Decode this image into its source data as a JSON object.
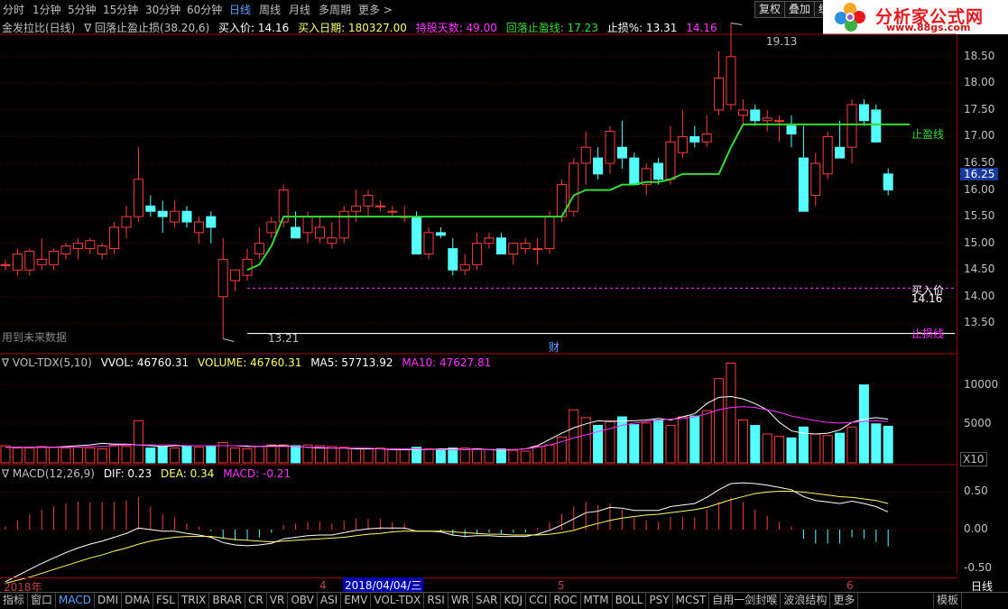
{
  "periods": [
    "分时",
    "1分钟",
    "5分钟",
    "15分钟",
    "30分钟",
    "60分钟",
    "日线",
    "周线",
    "月线",
    "多周期",
    "更多"
  ],
  "active_period": "日线",
  "right_buttons": [
    "复权",
    "叠加",
    "统"
  ],
  "logo": {
    "title": "分析家公式网",
    "url": "www.88gs.com"
  },
  "info": {
    "name": "金发拉比(日线)",
    "indicator": "∇ 回落止盈止损(38.20,6)",
    "buy_price": "买入价: 14.16",
    "buy_date": "买入日期: 180327.00",
    "hold_days": "持股天数: 49.00",
    "takeprofit_line": "回落止盈线: 17.23",
    "stoploss_pct": "止损%: 13.31",
    "value": "14.16"
  },
  "price_axis": [
    "18.50",
    "18.00",
    "17.50",
    "17.00",
    "16.50",
    "16.00",
    "15.50",
    "15.00",
    "14.50",
    "14.00",
    "13.50"
  ],
  "current_price_tag": "16.25",
  "labels": {
    "high": "19.13",
    "low": "13.21",
    "buy": "买入价",
    "buy_val": "14.16",
    "takeprofit": "止盈线",
    "stoploss": "止损线",
    "future": "用到未来数据",
    "cai": "财"
  },
  "volume_header": {
    "name": "∇ VOL-TDX(5,10)",
    "vvol": "VVOL: 46760.31",
    "volume": "VOLUME: 46760.31",
    "ma5": "MA5: 57713.92",
    "ma10": "MA10: 47627.81"
  },
  "volume_axis": [
    "10000",
    "5000"
  ],
  "volume_unit": "X10",
  "macd_header": {
    "name": "∇ MACD(12,26,9)",
    "dif": "DIF: 0.23",
    "dea": "DEA: 0.34",
    "macd": "MACD: -0.21"
  },
  "macd_axis": [
    "0.50",
    "0.00",
    "-0.50"
  ],
  "date_axis": [
    "2018年",
    "4",
    "5",
    "6"
  ],
  "cursor_date": "2018/04/04/三",
  "period_label": "日线",
  "bottom_tabs": [
    "指标",
    "窗口",
    "MACD",
    "DMI",
    "DMA",
    "FSL",
    "TRIX",
    "BRAR",
    "CR",
    "VR",
    "OBV",
    "ASI",
    "EMV",
    "VOL-TDX",
    "RSI",
    "WR",
    "SAR",
    "KDJ",
    "CCI",
    "ROC",
    "MTM",
    "BOLL",
    "PSY",
    "MCST",
    "自用一剑封喉",
    "波浪结构",
    "更多"
  ],
  "active_bottom_tab": "MACD",
  "template_tab": "模板",
  "colors": {
    "up": "#ff3c3c",
    "down": "#54ffff",
    "green": "#33dd33",
    "magenta": "#ff33ff",
    "white": "#ffffff",
    "yellow": "#ffff66"
  },
  "chart_data": {
    "type": "candlestick",
    "candles": [
      [
        14.6,
        14.7,
        14.5,
        14.6
      ],
      [
        14.5,
        14.9,
        14.4,
        14.8
      ],
      [
        14.5,
        14.9,
        14.4,
        14.85
      ],
      [
        14.6,
        15.1,
        14.5,
        14.7
      ],
      [
        14.6,
        14.9,
        14.5,
        14.85
      ],
      [
        14.8,
        15.0,
        14.7,
        14.95
      ],
      [
        14.9,
        15.1,
        14.7,
        15.0
      ],
      [
        14.9,
        15.1,
        14.8,
        15.05
      ],
      [
        14.8,
        15.0,
        14.7,
        14.95
      ],
      [
        14.9,
        15.4,
        14.8,
        15.3
      ],
      [
        15.3,
        15.7,
        15.1,
        15.5
      ],
      [
        15.5,
        16.8,
        15.4,
        16.2
      ],
      [
        15.7,
        15.9,
        15.5,
        15.6
      ],
      [
        15.6,
        15.8,
        15.2,
        15.5
      ],
      [
        15.4,
        15.8,
        15.3,
        15.6
      ],
      [
        15.6,
        15.7,
        15.3,
        15.4
      ],
      [
        15.2,
        15.5,
        15.0,
        15.4
      ],
      [
        15.5,
        15.6,
        15.0,
        15.3
      ],
      [
        14.0,
        15.1,
        13.21,
        14.7
      ],
      [
        14.3,
        14.5,
        14.1,
        14.5
      ],
      [
        14.4,
        14.9,
        14.3,
        14.7
      ],
      [
        14.8,
        15.3,
        14.7,
        15.0
      ],
      [
        15.2,
        15.5,
        15.1,
        15.4
      ],
      [
        15.4,
        16.1,
        15.3,
        16.0
      ],
      [
        15.3,
        15.6,
        15.1,
        15.1
      ],
      [
        15.2,
        15.6,
        15.0,
        15.5
      ],
      [
        15.1,
        15.5,
        15.0,
        15.3
      ],
      [
        15.0,
        15.4,
        14.9,
        15.1
      ],
      [
        15.1,
        15.7,
        15.0,
        15.6
      ],
      [
        15.6,
        16.0,
        15.4,
        15.7
      ],
      [
        15.7,
        16.0,
        15.5,
        15.9
      ],
      [
        15.7,
        15.8,
        15.6,
        15.7
      ],
      [
        15.6,
        15.7,
        15.5,
        15.6
      ],
      [
        15.5,
        15.7,
        15.4,
        15.5
      ],
      [
        15.5,
        15.6,
        14.8,
        14.8
      ],
      [
        14.8,
        15.3,
        14.7,
        15.2
      ],
      [
        15.2,
        15.3,
        15.1,
        15.15
      ],
      [
        14.9,
        15.1,
        14.4,
        14.5
      ],
      [
        14.5,
        14.8,
        14.4,
        14.6
      ],
      [
        14.6,
        15.2,
        14.5,
        15.0
      ],
      [
        15.0,
        15.2,
        14.9,
        15.1
      ],
      [
        15.1,
        15.2,
        14.8,
        14.8
      ],
      [
        14.8,
        15.0,
        14.6,
        15.0
      ],
      [
        14.9,
        15.1,
        14.8,
        15.0
      ],
      [
        14.9,
        15.1,
        14.6,
        14.9
      ],
      [
        14.9,
        15.6,
        14.8,
        15.5
      ],
      [
        15.5,
        16.2,
        15.4,
        16.1
      ],
      [
        15.6,
        16.6,
        15.5,
        16.5
      ],
      [
        16.5,
        17.1,
        16.1,
        16.8
      ],
      [
        16.6,
        16.8,
        16.2,
        16.3
      ],
      [
        16.5,
        17.2,
        16.3,
        17.1
      ],
      [
        16.8,
        17.3,
        16.4,
        16.6
      ],
      [
        16.6,
        16.7,
        16.1,
        16.1
      ],
      [
        16.1,
        16.5,
        15.9,
        16.4
      ],
      [
        16.5,
        16.6,
        16.1,
        16.2
      ],
      [
        16.2,
        17.2,
        16.1,
        16.9
      ],
      [
        16.7,
        17.5,
        16.6,
        17.0
      ],
      [
        17.0,
        17.2,
        16.8,
        16.9
      ],
      [
        16.9,
        17.4,
        16.8,
        17.05
      ],
      [
        17.5,
        18.6,
        17.4,
        18.1
      ],
      [
        17.6,
        19.13,
        17.5,
        18.5
      ],
      [
        17.4,
        17.7,
        17.2,
        17.5
      ],
      [
        17.5,
        17.6,
        17.2,
        17.3
      ],
      [
        17.3,
        17.5,
        17.1,
        17.35
      ],
      [
        17.3,
        17.4,
        16.9,
        17.3
      ],
      [
        17.2,
        17.4,
        16.8,
        17.05
      ],
      [
        16.6,
        17.2,
        15.7,
        15.6
      ],
      [
        15.9,
        16.7,
        15.7,
        16.5
      ],
      [
        16.3,
        17.1,
        16.2,
        17.0
      ],
      [
        16.8,
        17.3,
        16.6,
        16.6
      ],
      [
        16.8,
        17.7,
        16.5,
        17.6
      ],
      [
        17.6,
        17.7,
        17.2,
        17.3
      ],
      [
        17.5,
        17.6,
        16.9,
        16.9
      ],
      [
        16.3,
        16.4,
        15.9,
        16.0
      ]
    ],
    "takeprofit_line": {
      "start_index": 20,
      "values": [
        14.5,
        14.6,
        14.95,
        15.5,
        15.5,
        15.5,
        15.5,
        15.5,
        15.5,
        15.5,
        15.5,
        15.5,
        15.5,
        15.5,
        15.5,
        15.5,
        15.5,
        15.5,
        15.5,
        15.5,
        15.5,
        15.5,
        15.5,
        15.5,
        15.5,
        15.5,
        15.5,
        15.9,
        16.0,
        16.0,
        16.0,
        16.1,
        16.1,
        16.15,
        16.15,
        16.2,
        16.3,
        16.3,
        16.3,
        16.3,
        16.8,
        17.23,
        17.23,
        17.23,
        17.23,
        17.23,
        17.23,
        17.23,
        17.23,
        17.23,
        17.23,
        17.23,
        17.23,
        17.23
      ]
    },
    "buy_line": 14.16,
    "stop_line": 13.31,
    "volume": [
      2200,
      1900,
      1900,
      2100,
      2000,
      1900,
      2000,
      1900,
      1800,
      2300,
      2100,
      5400,
      1900,
      2100,
      1900,
      2100,
      2000,
      2100,
      2600,
      1900,
      1800,
      2100,
      2300,
      2300,
      2200,
      2300,
      2200,
      2100,
      2000,
      1900,
      1800,
      1900,
      1800,
      1700,
      2000,
      1800,
      1700,
      1900,
      1900,
      1800,
      1700,
      1800,
      1600,
      1500,
      2100,
      2300,
      3300,
      6800,
      5800,
      4800,
      5400,
      5900,
      4900,
      5100,
      5500,
      4800,
      5900,
      6000,
      6700,
      10800,
      12800,
      5500,
      4800,
      3700,
      3400,
      3200,
      4600,
      3700,
      3500,
      3800,
      4600,
      10000,
      5000,
      4700
    ],
    "vol_ma5": [
      2000,
      2000,
      2000,
      2000,
      2000,
      2100,
      2200,
      2300,
      2500,
      2400,
      2400,
      2300,
      2200,
      2100,
      2200,
      2200,
      2200,
      2200,
      2200,
      2200,
      2100,
      2100,
      2200,
      2200,
      2100,
      2000,
      1900,
      1900,
      1900,
      1800,
      1800,
      1800,
      1700,
      1700,
      1700,
      1700,
      1800,
      1800,
      1700,
      1800,
      1700,
      1600,
      1700,
      1800,
      2200,
      3000,
      3800,
      4500,
      5000,
      5400,
      5300,
      5400,
      5400,
      5500,
      5700,
      5500,
      5900,
      6300,
      7600,
      8400,
      8500,
      8200,
      7600,
      6800,
      5200,
      4100,
      3800,
      3700,
      3800,
      4200,
      5200,
      5600,
      5800,
      5600
    ],
    "vol_ma10": [
      2000,
      2000,
      2000,
      2000,
      2000,
      2000,
      2000,
      2100,
      2100,
      2200,
      2300,
      2300,
      2300,
      2300,
      2300,
      2200,
      2200,
      2200,
      2200,
      2200,
      2200,
      2100,
      2100,
      2100,
      2100,
      2000,
      2000,
      1900,
      1900,
      1900,
      1900,
      1800,
      1800,
      1800,
      1800,
      1700,
      1700,
      1700,
      1700,
      1700,
      1700,
      1700,
      1700,
      1800,
      2000,
      2300,
      2700,
      3200,
      3600,
      4000,
      4400,
      4800,
      5100,
      5300,
      5500,
      5600,
      5700,
      5900,
      6300,
      6800,
      7100,
      7200,
      7100,
      6800,
      6500,
      6000,
      5700,
      5400,
      5200,
      5100,
      5200,
      5300,
      5400,
      5300
    ],
    "dif": [
      -0.68,
      -0.6,
      -0.52,
      -0.44,
      -0.37,
      -0.3,
      -0.24,
      -0.19,
      -0.15,
      -0.1,
      -0.05,
      0.02,
      0.0,
      -0.02,
      -0.02,
      -0.05,
      -0.07,
      -0.1,
      -0.17,
      -0.2,
      -0.21,
      -0.2,
      -0.18,
      -0.12,
      -0.1,
      -0.08,
      -0.07,
      -0.07,
      -0.04,
      -0.01,
      0.01,
      0.02,
      0.02,
      0.02,
      -0.02,
      -0.02,
      -0.03,
      -0.07,
      -0.09,
      -0.08,
      -0.08,
      -0.09,
      -0.09,
      -0.09,
      -0.06,
      -0.01,
      0.06,
      0.14,
      0.22,
      0.24,
      0.29,
      0.28,
      0.25,
      0.25,
      0.25,
      0.3,
      0.32,
      0.34,
      0.42,
      0.52,
      0.6,
      0.61,
      0.6,
      0.58,
      0.55,
      0.52,
      0.43,
      0.38,
      0.36,
      0.34,
      0.37,
      0.34,
      0.3,
      0.23
    ],
    "dea": [
      -0.7,
      -0.66,
      -0.62,
      -0.57,
      -0.52,
      -0.47,
      -0.42,
      -0.37,
      -0.33,
      -0.28,
      -0.24,
      -0.19,
      -0.15,
      -0.12,
      -0.1,
      -0.09,
      -0.09,
      -0.09,
      -0.11,
      -0.13,
      -0.14,
      -0.15,
      -0.16,
      -0.15,
      -0.14,
      -0.13,
      -0.12,
      -0.11,
      -0.1,
      -0.08,
      -0.06,
      -0.05,
      -0.03,
      -0.02,
      -0.02,
      -0.02,
      -0.02,
      -0.03,
      -0.04,
      -0.05,
      -0.06,
      -0.06,
      -0.07,
      -0.07,
      -0.07,
      -0.06,
      -0.04,
      -0.01,
      0.04,
      0.08,
      0.12,
      0.15,
      0.17,
      0.19,
      0.2,
      0.22,
      0.24,
      0.26,
      0.29,
      0.34,
      0.39,
      0.43,
      0.47,
      0.49,
      0.5,
      0.5,
      0.49,
      0.47,
      0.45,
      0.43,
      0.42,
      0.4,
      0.38,
      0.34
    ]
  }
}
